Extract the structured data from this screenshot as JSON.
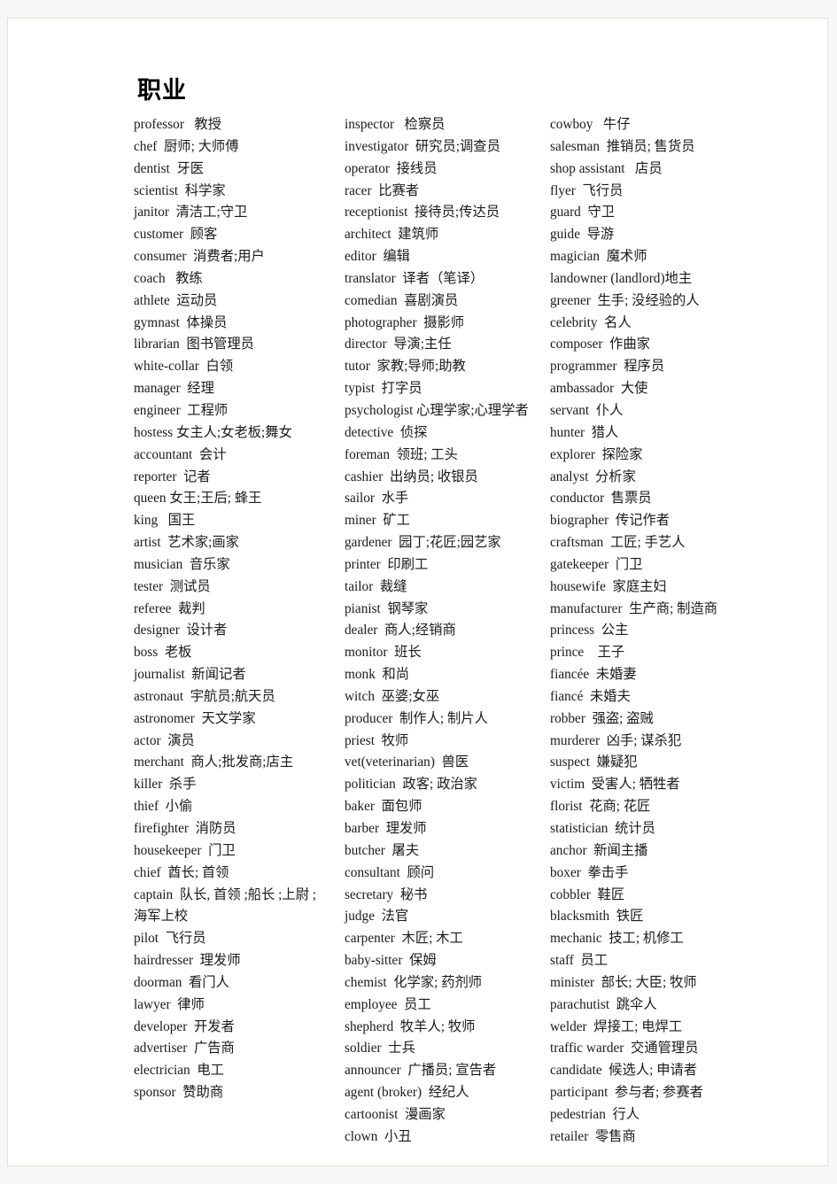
{
  "document": {
    "title": "职业",
    "columns": [
      {
        "id": "column-1",
        "entries": [
          "professor   教授",
          "chef  厨师; 大师傅",
          "dentist  牙医",
          "scientist  科学家",
          "janitor  清洁工;守卫",
          "customer  顾客",
          "consumer  消费者;用户",
          "coach   教练",
          "athlete  运动员",
          "gymnast  体操员",
          "librarian  图书管理员",
          "white-collar  白领",
          "manager  经理",
          "engineer  工程师",
          "hostess 女主人;女老板;舞女",
          "accountant  会计",
          "reporter  记者",
          "queen 女王;王后; 蜂王",
          "king   国王",
          "artist  艺术家;画家",
          "musician  音乐家",
          "tester  测试员",
          "referee  裁判",
          "designer  设计者",
          "boss  老板",
          "journalist  新闻记者",
          "astronaut  宇航员;航天员",
          "astronomer  天文学家",
          "actor  演员",
          "merchant  商人;批发商;店主",
          "killer  杀手",
          "thief  小偷",
          "firefighter  消防员",
          "housekeeper  门卫",
          "chief  酋长; 首领",
          "captain  队长, 首领 ;船长 ;上尉 ;\n海军上校",
          "pilot  飞行员",
          "hairdresser  理发师",
          "doorman  看门人",
          "lawyer  律师",
          "developer  开发者",
          "advertiser  广告商",
          "electrician  电工",
          "sponsor  赞助商"
        ]
      },
      {
        "id": "column-2",
        "entries": [
          "inspector   检察员",
          "investigator  研究员;调查员",
          "operator  接线员",
          "racer  比赛者",
          "receptionist  接待员;传达员",
          "architect  建筑师",
          "editor  编辑",
          "translator  译者（笔译）",
          "comedian  喜剧演员",
          "photographer  摄影师",
          "director  导演;主任",
          "tutor  家教;导师;助教",
          "typist  打字员",
          "psychologist 心理学家;心理学者",
          "detective  侦探",
          "foreman  领班; 工头",
          "cashier  出纳员; 收银员",
          "sailor  水手",
          "miner  矿工",
          "gardener  园丁;花匠;园艺家",
          "printer  印刷工",
          "tailor  裁缝",
          "pianist  钢琴家",
          "dealer  商人;经销商",
          "monitor  班长",
          "monk  和尚",
          "witch  巫婆;女巫",
          "producer  制作人; 制片人",
          "priest  牧师",
          "vet(veterinarian)  兽医",
          "politician  政客; 政治家",
          "baker  面包师",
          "barber  理发师",
          "butcher  屠夫",
          "consultant  顾问",
          "secretary  秘书",
          "judge  法官",
          "carpenter  木匠; 木工",
          "baby-sitter  保姆",
          "chemist  化学家; 药剂师",
          "employee  员工",
          "shepherd  牧羊人; 牧师",
          "soldier  士兵",
          "announcer  广播员; 宣告者",
          "agent (broker)  经纪人",
          "cartoonist  漫画家",
          "clown  小丑"
        ]
      },
      {
        "id": "column-3",
        "entries": [
          "cowboy   牛仔",
          "salesman  推销员; 售货员",
          "shop assistant   店员",
          "flyer  飞行员",
          "guard  守卫",
          "guide  导游",
          "magician  魔术师",
          "landowner (landlord)地主",
          "greener  生手; 没经验的人",
          "celebrity  名人",
          "composer  作曲家",
          "programmer  程序员",
          "ambassador  大使",
          "servant  仆人",
          "hunter  猎人",
          "explorer  探险家",
          "analyst  分析家",
          "conductor  售票员",
          "biographer  传记作者",
          "craftsman  工匠; 手艺人",
          "gatekeeper  门卫",
          "housewife  家庭主妇",
          "manufacturer  生产商; 制造商",
          "princess  公主",
          "prince    王子",
          "fiancée  未婚妻",
          "fiancé  未婚夫",
          "robber  强盗; 盗贼",
          "murderer  凶手; 谋杀犯",
          "suspect  嫌疑犯",
          "victim  受害人; 牺牲者",
          "florist  花商; 花匠",
          "statistician  统计员",
          "anchor  新闻主播",
          "boxer  拳击手",
          "cobbler  鞋匠",
          "blacksmith  铁匠",
          "mechanic  技工; 机修工",
          "staff  员工",
          "minister  部长; 大臣; 牧师",
          "parachutist  跳伞人",
          "welder  焊接工; 电焊工",
          "traffic warder  交通管理员",
          "candidate  候选人; 申请者",
          "participant  参与者; 参赛者",
          "pedestrian  行人",
          "retailer  零售商"
        ]
      }
    ]
  }
}
